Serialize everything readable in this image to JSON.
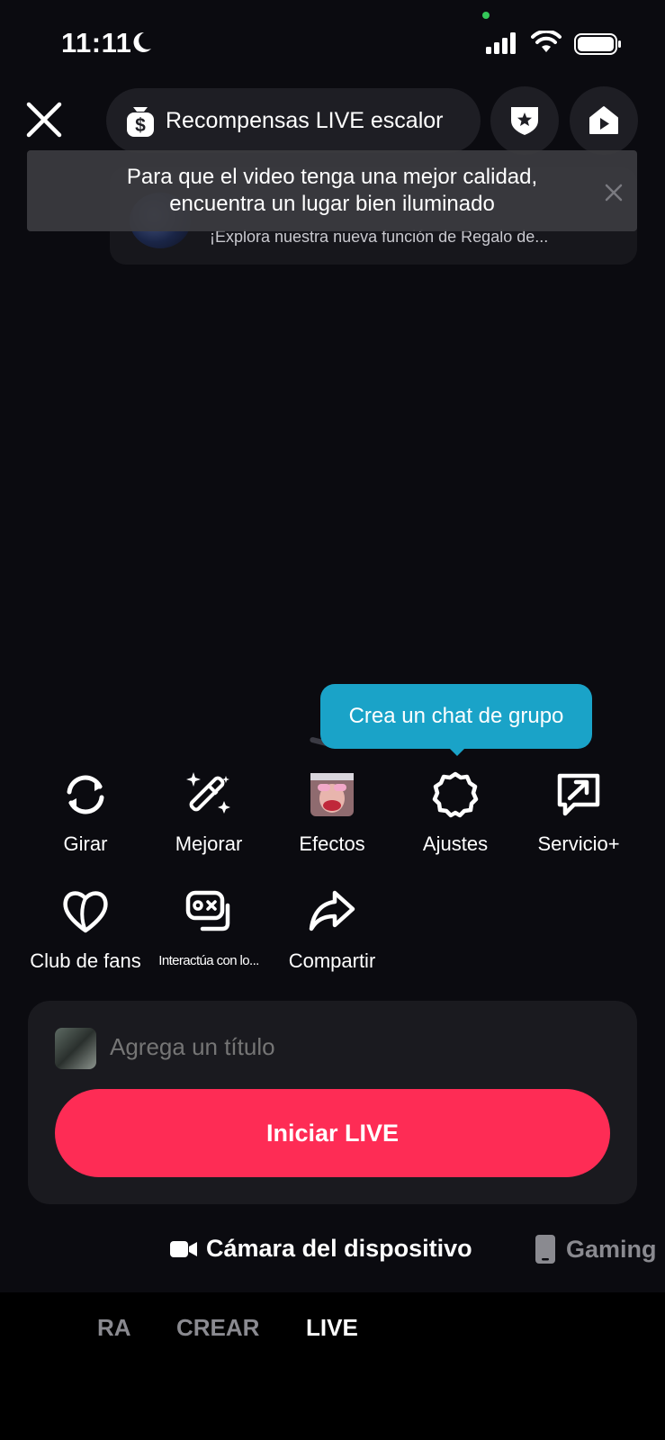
{
  "status_bar": {
    "time": "11:11"
  },
  "top": {
    "rewards_label": "Recompensas LIVE escalor"
  },
  "promo": {
    "text": "¡Explora nuestra nueva función de Regalo de..."
  },
  "toast": {
    "line1": "Para que el video tenga una mejor calidad,",
    "line2": "encuentra un lugar bien iluminado"
  },
  "tooltip": {
    "text": "Crea un chat de grupo"
  },
  "tools_row1": [
    {
      "label": "Girar",
      "icon": "rotate-icon"
    },
    {
      "label": "Mejorar",
      "icon": "magic-wand-icon"
    },
    {
      "label": "Efectos",
      "icon": "effects-thumbnail"
    },
    {
      "label": "Ajustes",
      "icon": "settings-gear-icon"
    },
    {
      "label": "Servicio+",
      "icon": "service-arrow-icon"
    }
  ],
  "tools_row2": [
    {
      "label": "Club de fans",
      "icon": "heart-icon"
    },
    {
      "label": "Interactúa con lo...",
      "icon": "game-chat-icon"
    },
    {
      "label": "Compartir",
      "icon": "share-arrow-icon"
    }
  ],
  "panel": {
    "title_placeholder": "Agrega un título",
    "start_label": "Iniciar LIVE"
  },
  "sources": {
    "camera": "Cámara del dispositivo",
    "gaming": "Gaming"
  },
  "modes": {
    "partial": "RA",
    "crear": "CREAR",
    "live": "LIVE"
  },
  "colors": {
    "accent": "#fe2c55",
    "tooltip": "#1aa3c8",
    "background": "#0b0b10"
  }
}
